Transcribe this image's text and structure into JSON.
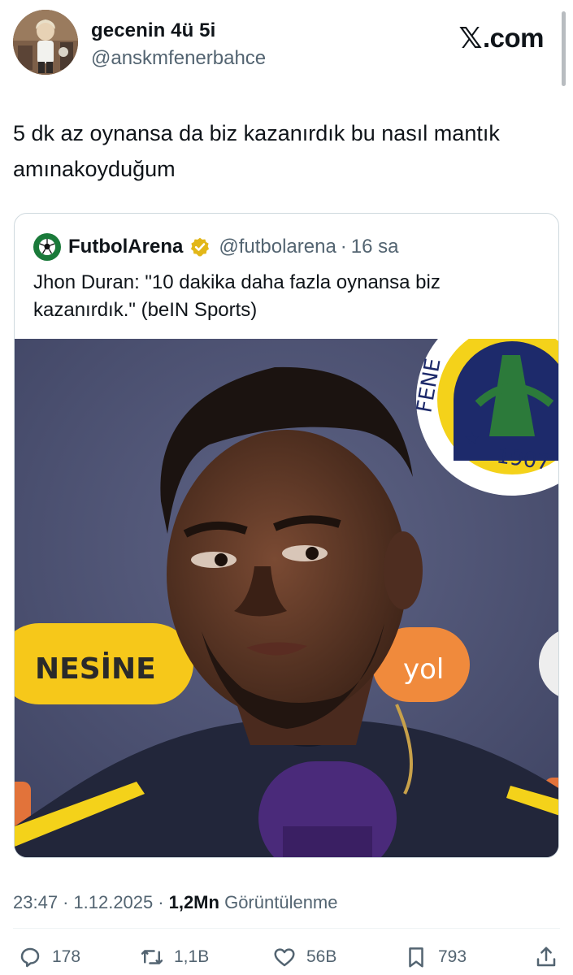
{
  "header": {
    "display_name": "gecenin 4ü 5i",
    "handle": "@anskmfenerbahce",
    "site_logo_x": "𝕏",
    "site_logo_rest": ".com"
  },
  "tweet": {
    "text": "5 dk az oynansa da biz kazanırdık bu nasıl mantık amınakoyduğum"
  },
  "quote": {
    "name": "FutbolArena",
    "handle": "@futbolarena",
    "separator": "·",
    "time": "16 sa",
    "text": "Jhon Duran: \"10 dakika daha fazla oynansa biz kazanırdık.\" (beIN Sports)",
    "media": {
      "sponsor_left": "NESİNE",
      "sponsor_right": "yol",
      "crest_text": "FENE",
      "crest_year": "1907"
    }
  },
  "meta": {
    "time": "23:47",
    "sep": "·",
    "date": "1.12.2025",
    "views_count": "1,2Mn",
    "views_label": "Görüntülenme"
  },
  "actions": {
    "replies": "178",
    "retweets": "1,1B",
    "likes": "56B",
    "bookmarks": "793"
  },
  "colors": {
    "text_primary": "#0f1419",
    "text_secondary": "#536471",
    "border": "#cfd9de",
    "verified_gold": "#e2b719"
  }
}
